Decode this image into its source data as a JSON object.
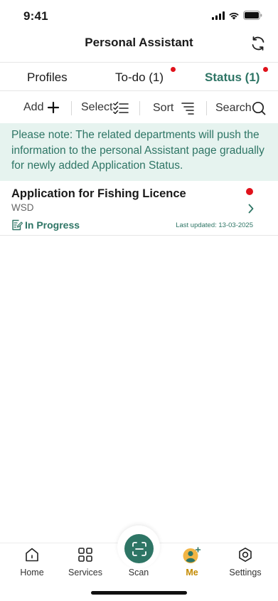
{
  "status_bar": {
    "time": "9:41"
  },
  "header": {
    "title": "Personal Assistant",
    "refresh_icon": "refresh-icon"
  },
  "tabs": [
    {
      "label": "Profiles",
      "active": false,
      "badge": false
    },
    {
      "label": "To-do (1)",
      "active": false,
      "badge": true
    },
    {
      "label": "Status (1)",
      "active": true,
      "badge": true
    }
  ],
  "toolbar": {
    "add_label": "Add",
    "select_label": "Select",
    "sort_label": "Sort",
    "search_label": "Search"
  },
  "notice": {
    "text": "Please note: The related departments will push the information to the personal Assistant page gradually for newly added Application Status."
  },
  "items": [
    {
      "title": "Application for Fishing Licence",
      "department": "WSD",
      "status": "In Progress",
      "last_updated": "Last updated: 13-03-2025",
      "unread": true
    }
  ],
  "tabbar": {
    "items": [
      {
        "label": "Home",
        "icon": "home-icon",
        "active": false
      },
      {
        "label": "Services",
        "icon": "grid-icon",
        "active": false
      },
      {
        "label": "Scan",
        "icon": "scan-icon",
        "active": false
      },
      {
        "label": "Me",
        "icon": "avatar-icon",
        "active": true
      },
      {
        "label": "Settings",
        "icon": "gear-icon",
        "active": false
      }
    ]
  },
  "colors": {
    "accent": "#2e7565",
    "notice_bg": "#e6f3ef",
    "badge_red": "#e0121b",
    "me_label": "#c48a00"
  }
}
